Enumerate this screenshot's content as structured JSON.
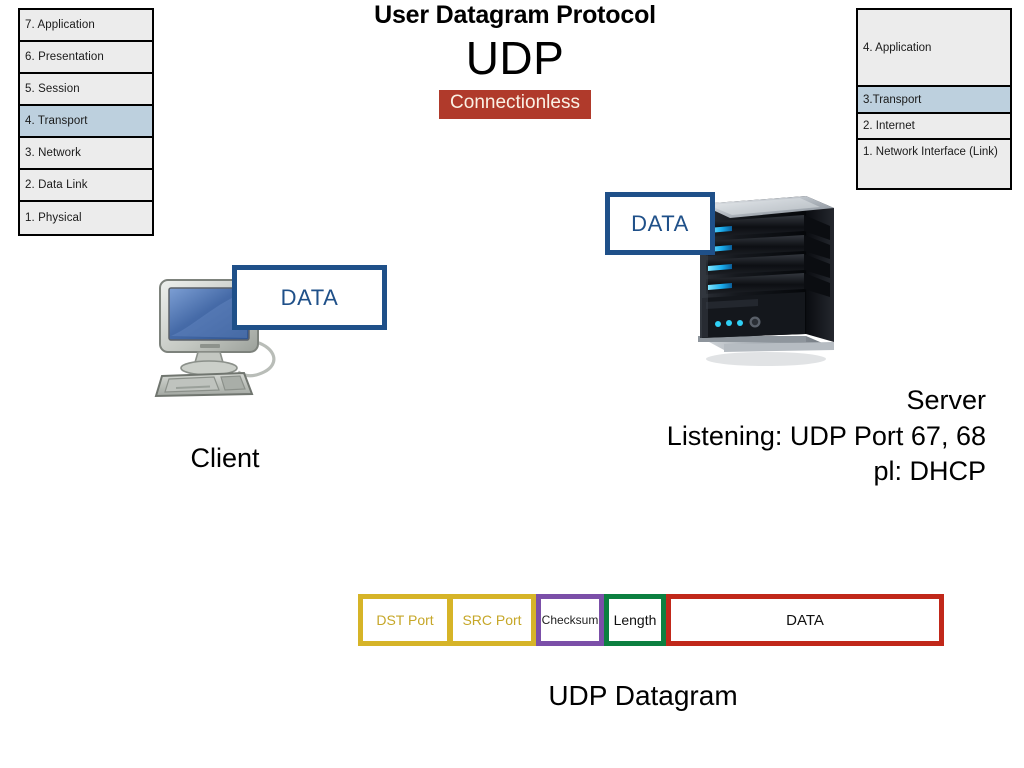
{
  "title": {
    "long": "User Datagram Protocol",
    "acronym": "UDP",
    "badge": "Connectionless"
  },
  "osi_stack": {
    "name": "osi-model",
    "items": [
      {
        "label": "7. Application",
        "highlight": false
      },
      {
        "label": "6. Presentation",
        "highlight": false
      },
      {
        "label": "5. Session",
        "highlight": false
      },
      {
        "label": "4. Transport",
        "highlight": true
      },
      {
        "label": "3. Network",
        "highlight": false
      },
      {
        "label": "2. Data Link",
        "highlight": false
      },
      {
        "label": "1. Physical",
        "highlight": false
      }
    ]
  },
  "tcpip_stack": {
    "name": "tcp-ip-model",
    "items": [
      {
        "label": "4. Application",
        "highlight": false
      },
      {
        "label": "3.Transport",
        "highlight": true
      },
      {
        "label": "2. Internet",
        "highlight": false
      },
      {
        "label": "1. Network Interface (Link)",
        "highlight": false
      }
    ]
  },
  "callouts": {
    "client_data": "DATA",
    "server_data": "DATA"
  },
  "endpoints": {
    "client_label": "Client",
    "server_label": "Server",
    "server_listening": "Listening: UDP Port 67, 68",
    "server_protocol": "pl: DHCP"
  },
  "datagram": {
    "caption": "UDP Datagram",
    "segments": [
      {
        "label": "DST Port",
        "color": "#D6B428"
      },
      {
        "label": "SRC Port",
        "color": "#D6B428"
      },
      {
        "label": "Checksum",
        "color": "#7B4FA8"
      },
      {
        "label": "Length",
        "color": "#0C8040"
      },
      {
        "label": "DATA",
        "color": "#C1281A"
      }
    ]
  },
  "colors": {
    "highlight_row": "#BDD0DE",
    "row_bg": "#ECECEC",
    "badge_bg": "#B03A2B",
    "callout_border": "#1F5089"
  }
}
